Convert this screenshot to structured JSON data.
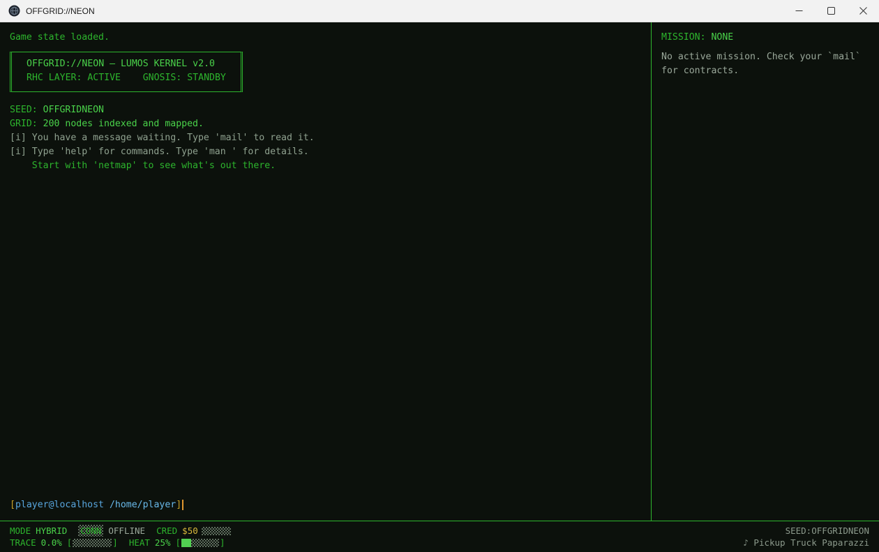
{
  "titlebar": {
    "title": "OFFGRID://NEON",
    "icons": {
      "app": "app-logo-icon",
      "minimize": "minimize-icon",
      "maximize": "maximize-icon",
      "close": "close-icon"
    }
  },
  "terminal": {
    "loaded_line": "Game state loaded.",
    "banner": {
      "line1": "OFFGRID://NEON — LUMOS KERNEL v2.0",
      "line2": "RHC LAYER: ACTIVE    GNOSIS: STANDBY"
    },
    "seed_label": "SEED:",
    "seed_value": " OFFGRIDNEON",
    "grid_label": "GRID:",
    "grid_value": " 200 nodes indexed and mapped.",
    "info_line1": "[i] You have a message waiting. Type 'mail' to read it.",
    "info_line2": "[i] Type 'help' for commands. Type 'man ' for details.",
    "hint_line": "    Start with 'netmap' to see what's out there.",
    "prompt": {
      "bracket_open": "[",
      "user_host": "player@localhost",
      "path": " /home/player",
      "bracket_close": "]"
    }
  },
  "sidebar": {
    "mission_label": "MISSION:",
    "mission_value": " NONE",
    "body_line1": "No active mission. Check your `mail`",
    "body_line2": "for contracts."
  },
  "statusbar": {
    "mode_label": "MODE",
    "mode_value": "HYBRID",
    "conn_label": "CONN",
    "conn_value": "OFFLINE",
    "cred_label": "CRED",
    "cred_value": "$50",
    "trace_label": "TRACE",
    "trace_value": "0.0%",
    "heat_label": "HEAT",
    "heat_value": "25%",
    "bar_open": "[",
    "bar_close": "]",
    "seed": "SEED:OFFGRIDNEON",
    "song": "♪ Pickup Truck Paparazzi"
  },
  "colors": {
    "background": "#0c110c",
    "green": "#2db52d",
    "bright_green": "#4ad24a",
    "dim_green": "#8fa18f",
    "gray": "#9aa89a",
    "yellow": "#d8b93c",
    "blue": "#58a6de",
    "cursor_orange": "#e0962e",
    "titlebar_bg": "#f2f2f2"
  }
}
